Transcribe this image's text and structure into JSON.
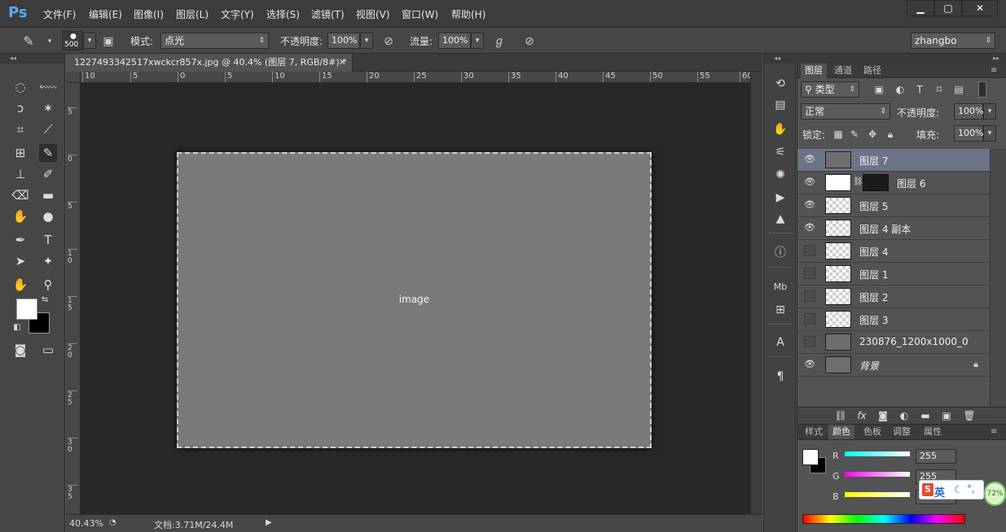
{
  "app": {
    "logo": "Ps"
  },
  "menu": {
    "items": [
      "文件(F)",
      "编辑(E)",
      "图像(I)",
      "图层(L)",
      "文字(Y)",
      "选择(S)",
      "滤镜(T)",
      "视图(V)",
      "窗口(W)",
      "帮助(H)"
    ]
  },
  "window_controls": {
    "minimize": "▁",
    "maximize": "▢",
    "close": "✕"
  },
  "options": {
    "brush_size": "500",
    "mode_label": "模式:",
    "mode_value": "点光",
    "opacity_label": "不透明度:",
    "opacity_value": "100%",
    "flow_label": "流量:",
    "flow_value": "100%",
    "workspace": "zhangbo"
  },
  "document": {
    "tab_title": "1227493342517xwckcr857x.jpg @ 40.4% (图层 7, RGB/8#) *",
    "close": "✕"
  },
  "rulers": {
    "h_ticks": [
      "10",
      "5",
      "0",
      "5",
      "10",
      "15",
      "20",
      "25",
      "30",
      "35",
      "40",
      "45",
      "50",
      "55",
      "60"
    ],
    "v_ticks": [
      "5",
      "0",
      "5",
      "1 0",
      "1 5",
      "2 0",
      "2 5",
      "3 0",
      "3 5"
    ]
  },
  "status": {
    "zoom": "40.43%",
    "doc_info": "文档:3.71M/24.4M"
  },
  "layers_panel": {
    "tabs": [
      "图层",
      "通道",
      "路径"
    ],
    "filter_kind": "类型",
    "blend_mode": "正常",
    "opacity_label": "不透明度:",
    "opacity_value": "100%",
    "lock_label": "锁定:",
    "fill_label": "填充:",
    "fill_value": "100%",
    "layers": [
      {
        "name": "图层 7",
        "visible": true,
        "selected": true
      },
      {
        "name": "图层 6",
        "visible": true,
        "selected": false
      },
      {
        "name": "图层 5",
        "visible": true,
        "selected": false
      },
      {
        "name": "图层 4 副本",
        "visible": true,
        "selected": false
      },
      {
        "name": "图层 4",
        "visible": false,
        "selected": false
      },
      {
        "name": "图层 1",
        "visible": false,
        "selected": false
      },
      {
        "name": "图层 2",
        "visible": false,
        "selected": false
      },
      {
        "name": "图层 3",
        "visible": false,
        "selected": false
      },
      {
        "name": "230876_1200x1000_0",
        "visible": false,
        "selected": false
      },
      {
        "name": "背景",
        "visible": true,
        "selected": false
      }
    ]
  },
  "color_panel": {
    "tabs": [
      "样式",
      "颜色",
      "色板",
      "调整",
      "属性"
    ],
    "r_label": "R",
    "g_label": "G",
    "b_label": "B",
    "r_value": "255",
    "g_value": "255",
    "b_value": ""
  },
  "ime": {
    "text": "英"
  },
  "battery": {
    "percent": "72%"
  },
  "colors": {
    "accent": "#5aa8ff",
    "selected_layer": "#6b7488"
  }
}
